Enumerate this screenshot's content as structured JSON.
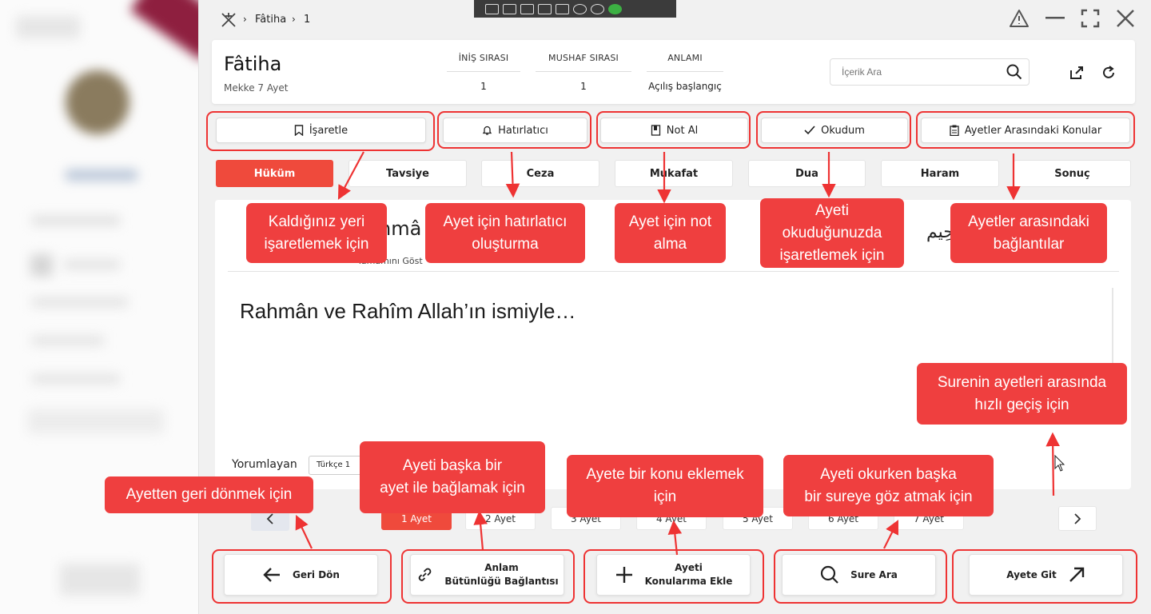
{
  "breadcrumb": {
    "surah": "Fâtiha",
    "verse": "1"
  },
  "header": {
    "title": "Fâtiha",
    "place": "Mekke",
    "ayah_count_label": "7 Ayet",
    "stats": [
      {
        "label": "İNİŞ SIRASI",
        "value": "1"
      },
      {
        "label": "MUSHAF SIRASI",
        "value": "1"
      },
      {
        "label": "ANLAMI",
        "value": "Açılış başlangıç"
      }
    ],
    "search_placeholder": "İçerik Ara"
  },
  "toolbar": [
    {
      "label": "İşaretle",
      "icon": "bookmark-icon"
    },
    {
      "label": "Hatırlatıcı",
      "icon": "bell-icon"
    },
    {
      "label": "Not Al",
      "icon": "note-icon"
    },
    {
      "label": "Okudum",
      "icon": "check-icon"
    },
    {
      "label": "Ayetler Arasındaki Konular",
      "icon": "clipboard-icon"
    }
  ],
  "categories": [
    {
      "label": "Hüküm",
      "active": true
    },
    {
      "label": "Tavsiye"
    },
    {
      "label": "Ceza"
    },
    {
      "label": "Mukafat"
    },
    {
      "label": "Dua"
    },
    {
      "label": "Haram"
    },
    {
      "label": "Sonuç"
    }
  ],
  "verse": {
    "heading_partial": "hmâ",
    "show_all_partial": "Tamamını Göst",
    "arabic_partial": "حِيم",
    "translation": "Rahmân ve Rahîm Allah’ın ismiyle…",
    "commentator_label": "Yorumlayan",
    "commentator_select": "Türkçe 1"
  },
  "pagination": [
    "1 Ayet",
    "2 Ayet",
    "3 Ayet",
    "4 Ayet",
    "5 Ayet",
    "6 Ayet",
    "7 Ayet"
  ],
  "actions": [
    {
      "label": "Geri Dön",
      "icon": "arrow-left-icon"
    },
    {
      "line1": "Anlam",
      "line2": "Bütünlüğü  Bağlantısı",
      "icon": "link-icon"
    },
    {
      "line1": "Ayeti",
      "line2": "Konularıma Ekle",
      "icon": "plus-icon"
    },
    {
      "label": "Sure Ara",
      "icon": "search-icon"
    },
    {
      "label": "Ayete Git",
      "icon": "arrow-up-right-icon"
    }
  ],
  "callouts": {
    "bookmark": [
      "Kaldığınız yeri",
      "işaretlemek için"
    ],
    "reminder": [
      "Ayet için hatırlatıcı",
      "oluşturma"
    ],
    "note": [
      "Ayet için not",
      "alma"
    ],
    "read": [
      "Ayeti",
      "okuduğunuzda",
      "işaretlemek için"
    ],
    "topics": [
      "Ayetler arasındaki",
      "bağlantılar"
    ],
    "goto": [
      "Surenin ayetleri arasında",
      "hızlı geçiş için"
    ],
    "link": [
      "Ayeti başka bir",
      "ayet ile bağlamak için"
    ],
    "add_topic": [
      "Ayete bir konu eklemek",
      "için"
    ],
    "sure_search": [
      "Ayeti okurken başka",
      "bir sureye göz atmak için"
    ],
    "back": [
      "Ayetten geri dönmek için"
    ]
  },
  "colors": {
    "accent": "#ef4a3c",
    "callout": "#ef3f3f",
    "sidebar_accent": "#8e1f3f"
  }
}
